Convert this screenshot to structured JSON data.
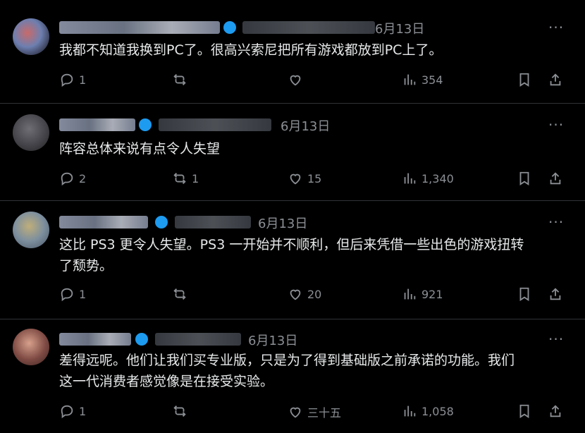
{
  "posts": [
    {
      "date": "6月13日",
      "text_lines": [
        "我都不知道我换到PC了。很高兴索尼把所有游戏都放到PC上了。"
      ],
      "counts": {
        "reply": "1",
        "repost": "",
        "like": "",
        "views": "354"
      }
    },
    {
      "date": "6月13日",
      "text_lines": [
        "阵容总体来说有点令人失望"
      ],
      "counts": {
        "reply": "2",
        "repost": "1",
        "like": "15",
        "views": "1,340"
      }
    },
    {
      "date": "6月13日",
      "text_lines": [
        "这比 PS3 更令人失望。PS3 一开始并不顺利，但后来凭借一些出色的游戏扭转",
        "了颓势。"
      ],
      "counts": {
        "reply": "1",
        "repost": "",
        "like": "20",
        "views": "921"
      }
    },
    {
      "date": "6月13日",
      "text_lines": [
        "差得远呢。他们让我们买专业版，只是为了得到基础版之前承诺的功能。我们",
        "这一代消费者感觉像是在接受实验。"
      ],
      "counts": {
        "reply": "1",
        "repost": "",
        "like": "三十五",
        "views": "1,058"
      }
    }
  ],
  "icons": {
    "reply": "reply-icon",
    "repost": "repost-icon",
    "like": "like-icon",
    "views": "views-icon",
    "bookmark": "bookmark-icon",
    "share": "share-icon",
    "more": "more-icon",
    "verified": "verified-badge-icon"
  },
  "colors": {
    "background": "#000000",
    "text": "#e7e9ea",
    "muted": "#8b8f94",
    "verified": "#1d9bf0"
  }
}
